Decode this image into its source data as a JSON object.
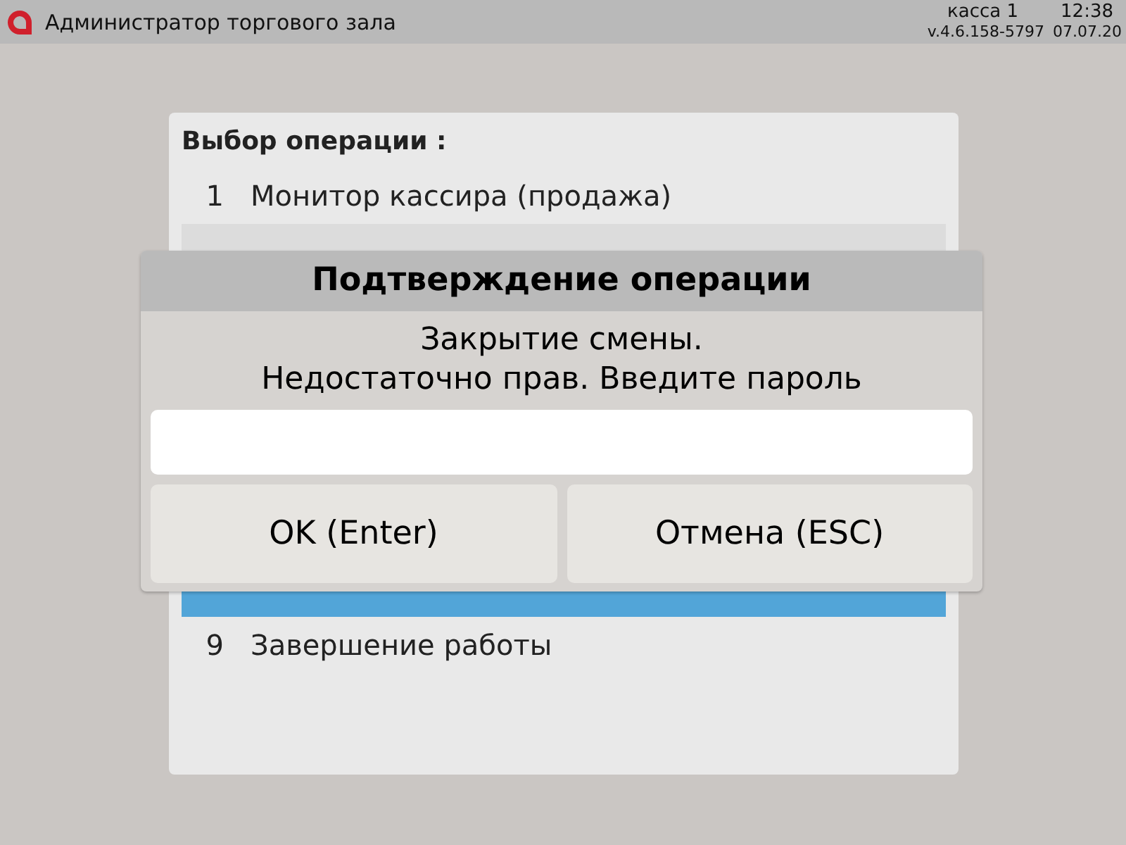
{
  "top_bar": {
    "title": "Администратор торгового зала",
    "register": "касса 1",
    "time": "12:38",
    "version": "v.4.6.158-5797",
    "date": "07.07.20"
  },
  "menu": {
    "title": "Выбор операции :",
    "items": [
      {
        "number": "1",
        "label": "Монитор кассира (продажа)",
        "selected": false,
        "highlighted": false
      },
      {
        "selected": false,
        "highlighted": true
      },
      {
        "selected": true,
        "highlighted": false
      },
      {
        "number": "9",
        "label": "Завершение работы",
        "selected": false,
        "highlighted": false
      }
    ]
  },
  "dialog": {
    "title": "Подтверждение операции",
    "message_lines": [
      "Закрытие смены.",
      "Недостаточно прав. Введите пароль"
    ],
    "buttons": [
      {
        "label": "OK (Enter)"
      },
      {
        "label": "Отмена (ESC)"
      }
    ]
  }
}
